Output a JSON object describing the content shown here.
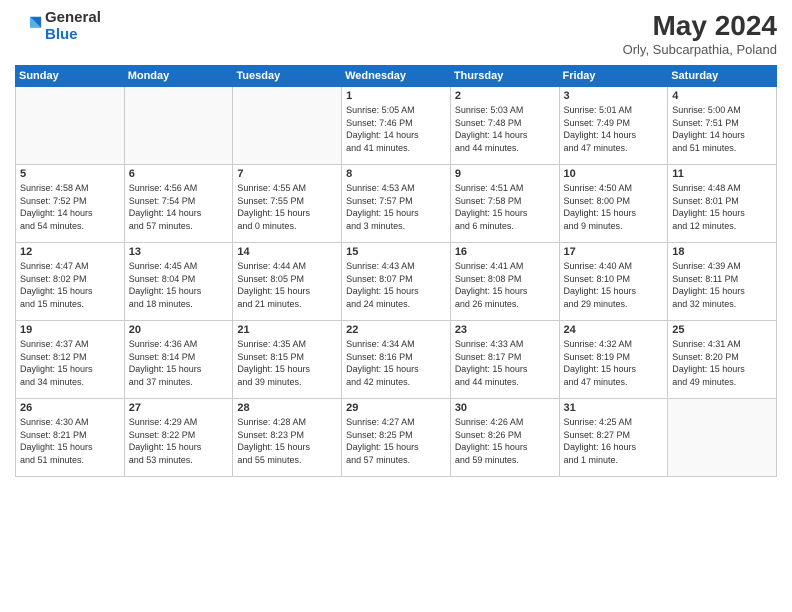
{
  "logo": {
    "general": "General",
    "blue": "Blue"
  },
  "header": {
    "month_year": "May 2024",
    "location": "Orly, Subcarpathia, Poland"
  },
  "weekdays": [
    "Sunday",
    "Monday",
    "Tuesday",
    "Wednesday",
    "Thursday",
    "Friday",
    "Saturday"
  ],
  "weeks": [
    [
      {
        "day": "",
        "info": ""
      },
      {
        "day": "",
        "info": ""
      },
      {
        "day": "",
        "info": ""
      },
      {
        "day": "1",
        "info": "Sunrise: 5:05 AM\nSunset: 7:46 PM\nDaylight: 14 hours\nand 41 minutes."
      },
      {
        "day": "2",
        "info": "Sunrise: 5:03 AM\nSunset: 7:48 PM\nDaylight: 14 hours\nand 44 minutes."
      },
      {
        "day": "3",
        "info": "Sunrise: 5:01 AM\nSunset: 7:49 PM\nDaylight: 14 hours\nand 47 minutes."
      },
      {
        "day": "4",
        "info": "Sunrise: 5:00 AM\nSunset: 7:51 PM\nDaylight: 14 hours\nand 51 minutes."
      }
    ],
    [
      {
        "day": "5",
        "info": "Sunrise: 4:58 AM\nSunset: 7:52 PM\nDaylight: 14 hours\nand 54 minutes."
      },
      {
        "day": "6",
        "info": "Sunrise: 4:56 AM\nSunset: 7:54 PM\nDaylight: 14 hours\nand 57 minutes."
      },
      {
        "day": "7",
        "info": "Sunrise: 4:55 AM\nSunset: 7:55 PM\nDaylight: 15 hours\nand 0 minutes."
      },
      {
        "day": "8",
        "info": "Sunrise: 4:53 AM\nSunset: 7:57 PM\nDaylight: 15 hours\nand 3 minutes."
      },
      {
        "day": "9",
        "info": "Sunrise: 4:51 AM\nSunset: 7:58 PM\nDaylight: 15 hours\nand 6 minutes."
      },
      {
        "day": "10",
        "info": "Sunrise: 4:50 AM\nSunset: 8:00 PM\nDaylight: 15 hours\nand 9 minutes."
      },
      {
        "day": "11",
        "info": "Sunrise: 4:48 AM\nSunset: 8:01 PM\nDaylight: 15 hours\nand 12 minutes."
      }
    ],
    [
      {
        "day": "12",
        "info": "Sunrise: 4:47 AM\nSunset: 8:02 PM\nDaylight: 15 hours\nand 15 minutes."
      },
      {
        "day": "13",
        "info": "Sunrise: 4:45 AM\nSunset: 8:04 PM\nDaylight: 15 hours\nand 18 minutes."
      },
      {
        "day": "14",
        "info": "Sunrise: 4:44 AM\nSunset: 8:05 PM\nDaylight: 15 hours\nand 21 minutes."
      },
      {
        "day": "15",
        "info": "Sunrise: 4:43 AM\nSunset: 8:07 PM\nDaylight: 15 hours\nand 24 minutes."
      },
      {
        "day": "16",
        "info": "Sunrise: 4:41 AM\nSunset: 8:08 PM\nDaylight: 15 hours\nand 26 minutes."
      },
      {
        "day": "17",
        "info": "Sunrise: 4:40 AM\nSunset: 8:10 PM\nDaylight: 15 hours\nand 29 minutes."
      },
      {
        "day": "18",
        "info": "Sunrise: 4:39 AM\nSunset: 8:11 PM\nDaylight: 15 hours\nand 32 minutes."
      }
    ],
    [
      {
        "day": "19",
        "info": "Sunrise: 4:37 AM\nSunset: 8:12 PM\nDaylight: 15 hours\nand 34 minutes."
      },
      {
        "day": "20",
        "info": "Sunrise: 4:36 AM\nSunset: 8:14 PM\nDaylight: 15 hours\nand 37 minutes."
      },
      {
        "day": "21",
        "info": "Sunrise: 4:35 AM\nSunset: 8:15 PM\nDaylight: 15 hours\nand 39 minutes."
      },
      {
        "day": "22",
        "info": "Sunrise: 4:34 AM\nSunset: 8:16 PM\nDaylight: 15 hours\nand 42 minutes."
      },
      {
        "day": "23",
        "info": "Sunrise: 4:33 AM\nSunset: 8:17 PM\nDaylight: 15 hours\nand 44 minutes."
      },
      {
        "day": "24",
        "info": "Sunrise: 4:32 AM\nSunset: 8:19 PM\nDaylight: 15 hours\nand 47 minutes."
      },
      {
        "day": "25",
        "info": "Sunrise: 4:31 AM\nSunset: 8:20 PM\nDaylight: 15 hours\nand 49 minutes."
      }
    ],
    [
      {
        "day": "26",
        "info": "Sunrise: 4:30 AM\nSunset: 8:21 PM\nDaylight: 15 hours\nand 51 minutes."
      },
      {
        "day": "27",
        "info": "Sunrise: 4:29 AM\nSunset: 8:22 PM\nDaylight: 15 hours\nand 53 minutes."
      },
      {
        "day": "28",
        "info": "Sunrise: 4:28 AM\nSunset: 8:23 PM\nDaylight: 15 hours\nand 55 minutes."
      },
      {
        "day": "29",
        "info": "Sunrise: 4:27 AM\nSunset: 8:25 PM\nDaylight: 15 hours\nand 57 minutes."
      },
      {
        "day": "30",
        "info": "Sunrise: 4:26 AM\nSunset: 8:26 PM\nDaylight: 15 hours\nand 59 minutes."
      },
      {
        "day": "31",
        "info": "Sunrise: 4:25 AM\nSunset: 8:27 PM\nDaylight: 16 hours\nand 1 minute."
      },
      {
        "day": "",
        "info": ""
      }
    ]
  ]
}
